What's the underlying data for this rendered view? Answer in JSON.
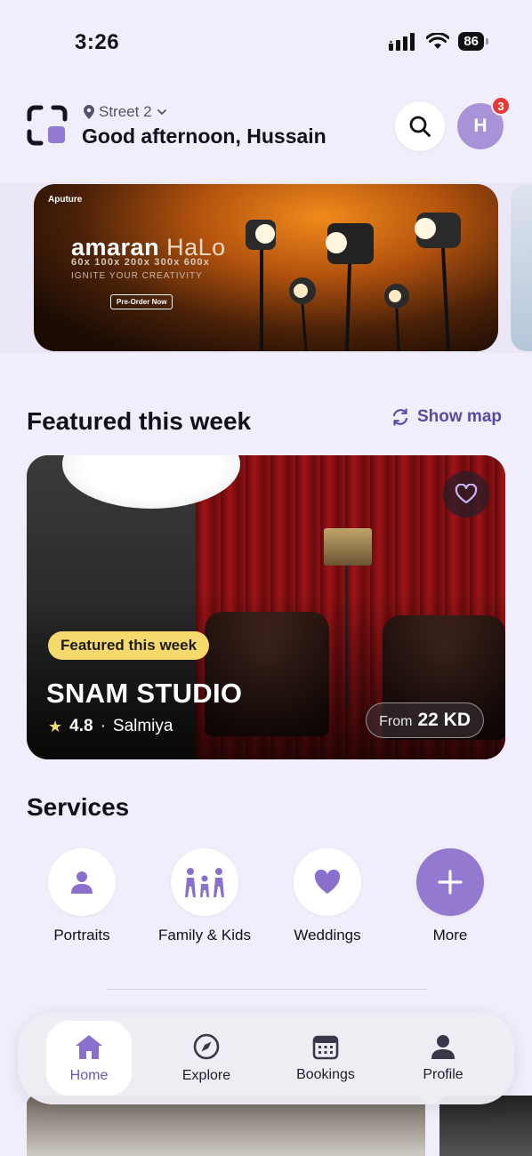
{
  "status": {
    "time": "3:26",
    "battery": "86"
  },
  "header": {
    "location": "Street 2",
    "greeting": "Good afternoon, Hussain",
    "avatar_initial": "H",
    "notification_count": "3"
  },
  "banner": {
    "brand": "Aputure",
    "title_main": "amaran",
    "title_sub": "HaLo",
    "models": "60x 100x 200x 300x 600x",
    "tagline": "IGNITE YOUR CREATIVITY",
    "cta": "Pre-Order Now"
  },
  "featured": {
    "section_title": "Featured this week",
    "show_map_label": "Show map",
    "card": {
      "tag": "Featured this week",
      "name": "SNAM STUDIO",
      "rating": "4.8",
      "location": "Salmiya",
      "price_prefix": "From",
      "price": "22 KD"
    }
  },
  "services": {
    "title": "Services",
    "items": [
      {
        "label": "Portraits",
        "icon": "person-icon"
      },
      {
        "label": "Family & Kids",
        "icon": "family-icon"
      },
      {
        "label": "Weddings",
        "icon": "heart-icon"
      },
      {
        "label": "More",
        "icon": "plus-icon"
      }
    ]
  },
  "tabbar": {
    "items": [
      {
        "label": "Home",
        "icon": "home-icon",
        "active": true
      },
      {
        "label": "Explore",
        "icon": "compass-icon",
        "active": false
      },
      {
        "label": "Bookings",
        "icon": "calendar-icon",
        "active": false
      },
      {
        "label": "Profile",
        "icon": "profile-icon",
        "active": false
      }
    ]
  },
  "colors": {
    "accent": "#9479d1",
    "accent_text": "#5b4aa0",
    "background": "#f1eefb",
    "tag_yellow": "#f5d96c",
    "badge_red": "#e53935"
  }
}
